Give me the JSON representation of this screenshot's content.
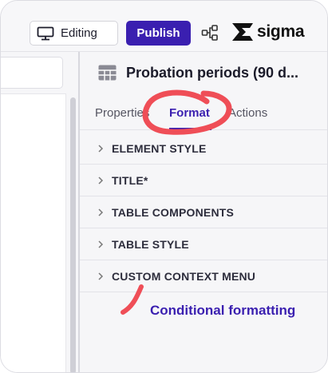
{
  "toolbar": {
    "editing_label": "Editing",
    "publish_label": "Publish",
    "logo_text": "sigma",
    "icons": {
      "monitor": "monitor-icon",
      "share": "share-graph-icon",
      "logo": "sigma-logo-icon"
    }
  },
  "panel": {
    "title": "Probation periods (90 d...",
    "title_icon": "table-icon",
    "tabs": [
      {
        "label": "Properties"
      },
      {
        "label": "Format"
      },
      {
        "label": "Actions"
      }
    ],
    "sections": [
      {
        "label": "ELEMENT STYLE"
      },
      {
        "label": "TITLE*"
      },
      {
        "label": "TABLE COMPONENTS"
      },
      {
        "label": "TABLE STYLE"
      },
      {
        "label": "CUSTOM CONTEXT MENU"
      }
    ],
    "conditional_link": "Conditional formatting"
  },
  "colors": {
    "accent": "#3a1fb0",
    "annotation": "#ef4e57"
  }
}
